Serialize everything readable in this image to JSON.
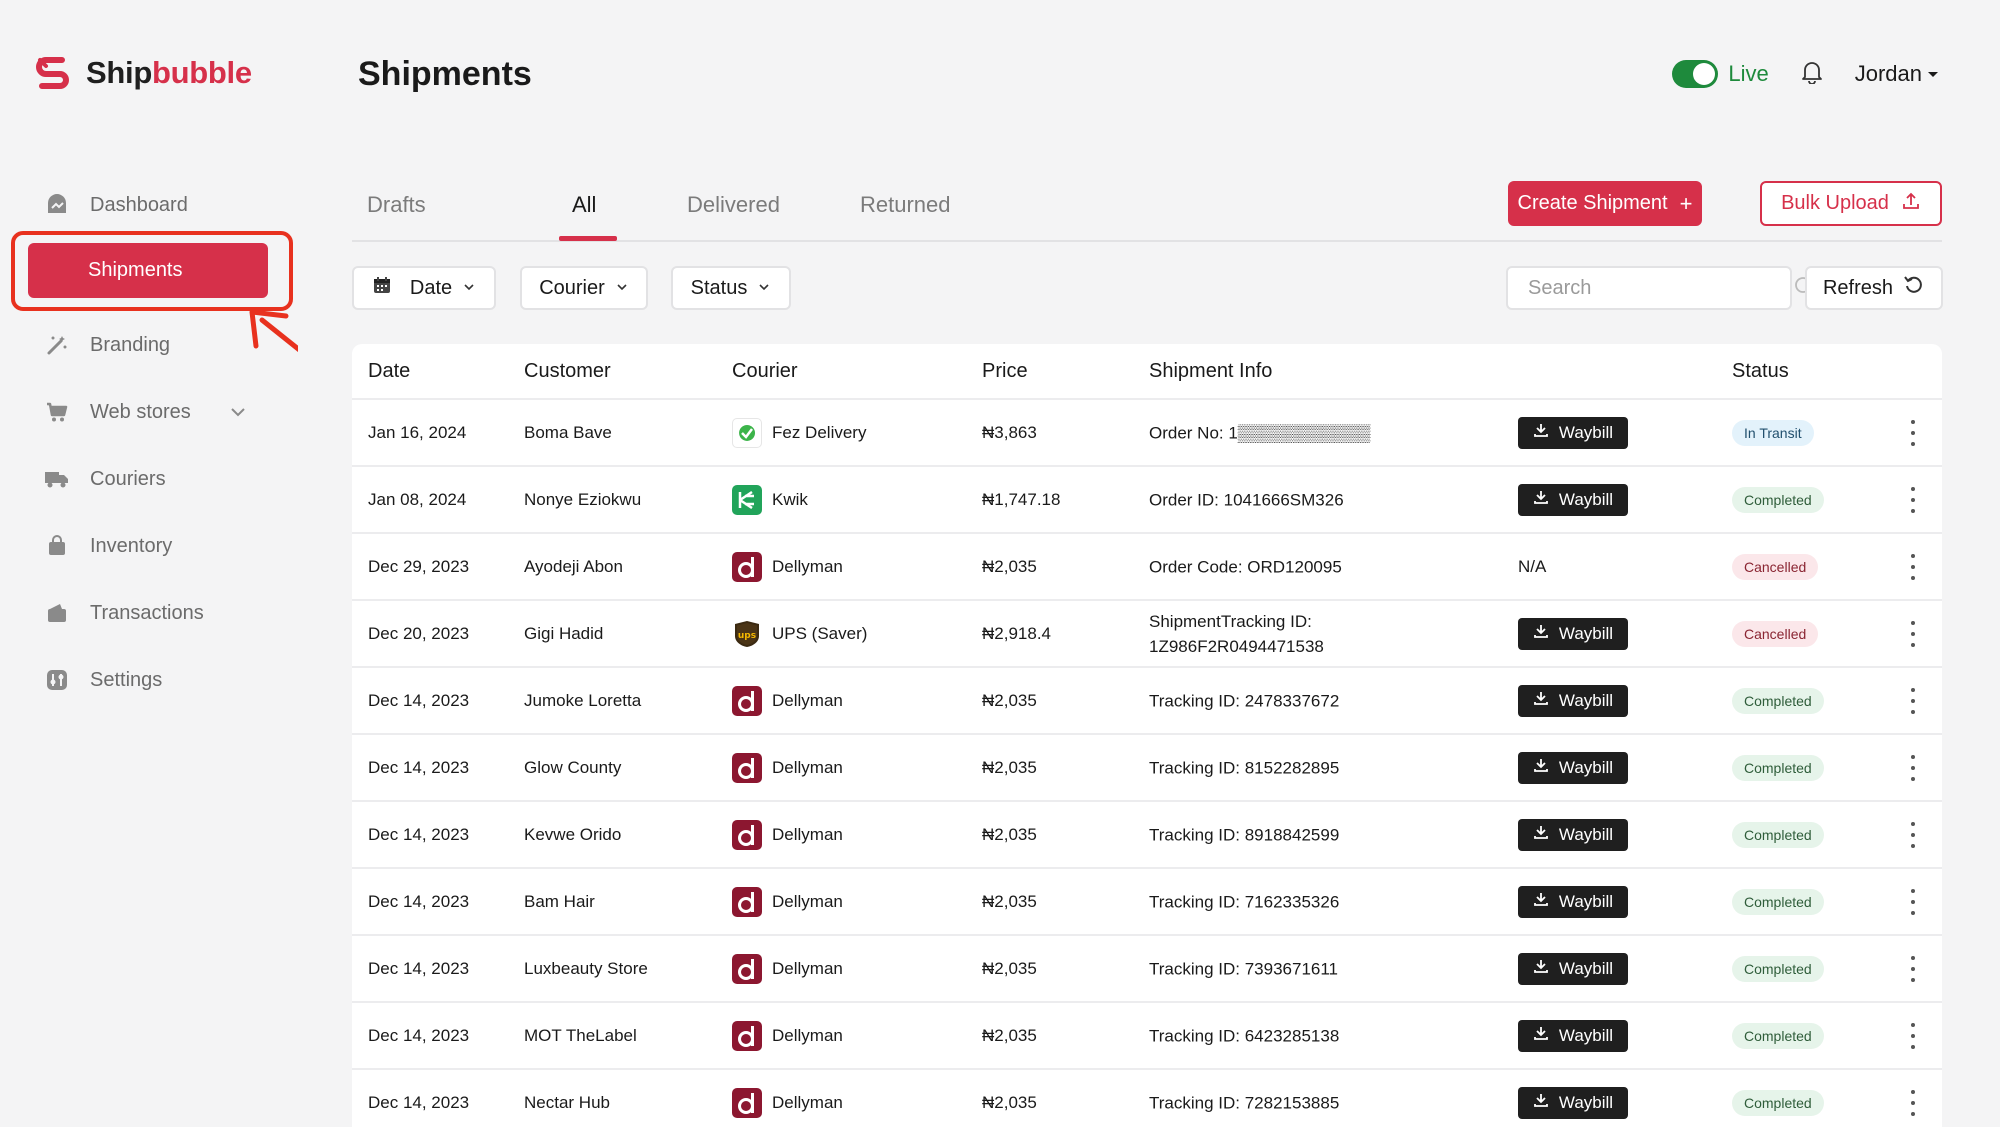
{
  "app": {
    "brand_ship": "Ship",
    "brand_bubble": "bubble",
    "accent_color": "#d6304a"
  },
  "sidebar": {
    "items": [
      {
        "label": "Dashboard",
        "icon": "chart-icon",
        "active": false
      },
      {
        "label": "Shipments",
        "icon": "box-icon",
        "active": true
      },
      {
        "label": "Branding",
        "icon": "magic-wand-icon",
        "active": false
      },
      {
        "label": "Web stores",
        "icon": "cart-icon",
        "active": false,
        "expandable": true
      },
      {
        "label": "Couriers",
        "icon": "truck-icon",
        "active": false
      },
      {
        "label": "Inventory",
        "icon": "bag-icon",
        "active": false
      },
      {
        "label": "Transactions",
        "icon": "wallet-icon",
        "active": false
      },
      {
        "label": "Settings",
        "icon": "settings-icon",
        "active": false
      }
    ]
  },
  "header": {
    "title": "Shipments",
    "live_label": "Live",
    "user_name": "Jordan"
  },
  "tabs": [
    {
      "label": "Drafts",
      "active": false
    },
    {
      "label": "All",
      "active": true
    },
    {
      "label": "Delivered",
      "active": false
    },
    {
      "label": "Returned",
      "active": false
    }
  ],
  "actions": {
    "create_label": "Create Shipment",
    "create_suffix": "+",
    "bulk_label": "Bulk Upload"
  },
  "filters": {
    "date_label": "Date",
    "courier_label": "Courier",
    "status_label": "Status",
    "search_placeholder": "Search",
    "refresh_label": "Refresh"
  },
  "table": {
    "columns": [
      "Date",
      "Customer",
      "Courier",
      "Price",
      "Shipment Info",
      "Status"
    ],
    "waybill_label": "Waybill",
    "rows": [
      {
        "date": "Jan 16, 2024",
        "customer": "Boma Bave",
        "courier": "Fez Delivery",
        "courier_logo": "fez",
        "price": "₦3,863",
        "info": "Order No: 1▒▒▒▒▒▒▒▒▒▒▒",
        "info2": "",
        "waybill": true,
        "na": "",
        "status": "In Transit",
        "status_type": "transit"
      },
      {
        "date": "Jan 08, 2024",
        "customer": "Nonye Eziokwu",
        "courier": "Kwik",
        "courier_logo": "kwik",
        "price": "₦1,747.18",
        "info": "Order ID: 1041666SM326",
        "info2": "",
        "waybill": true,
        "na": "",
        "status": "Completed",
        "status_type": "completed"
      },
      {
        "date": "Dec 29, 2023",
        "customer": "Ayodeji Abon",
        "courier": "Dellyman",
        "courier_logo": "dellyman",
        "price": "₦2,035",
        "info": "Order Code: ORD120095",
        "info2": "",
        "waybill": false,
        "na": "N/A",
        "status": "Cancelled",
        "status_type": "cancelled"
      },
      {
        "date": "Dec 20, 2023",
        "customer": "Gigi Hadid",
        "courier": "UPS (Saver)",
        "courier_logo": "ups",
        "price": "₦2,918.4",
        "info": "ShipmentTracking ID:",
        "info2": "1Z986F2R0494471538",
        "waybill": true,
        "na": "",
        "status": "Cancelled",
        "status_type": "cancelled"
      },
      {
        "date": "Dec 14, 2023",
        "customer": "Jumoke Loretta",
        "courier": "Dellyman",
        "courier_logo": "dellyman",
        "price": "₦2,035",
        "info": "Tracking ID: 2478337672",
        "info2": "",
        "waybill": true,
        "na": "",
        "status": "Completed",
        "status_type": "completed"
      },
      {
        "date": "Dec 14, 2023",
        "customer": "Glow County",
        "courier": "Dellyman",
        "courier_logo": "dellyman",
        "price": "₦2,035",
        "info": "Tracking ID: 8152282895",
        "info2": "",
        "waybill": true,
        "na": "",
        "status": "Completed",
        "status_type": "completed"
      },
      {
        "date": "Dec 14, 2023",
        "customer": "Kevwe Orido",
        "courier": "Dellyman",
        "courier_logo": "dellyman",
        "price": "₦2,035",
        "info": "Tracking ID: 8918842599",
        "info2": "",
        "waybill": true,
        "na": "",
        "status": "Completed",
        "status_type": "completed"
      },
      {
        "date": "Dec 14, 2023",
        "customer": "Bam Hair",
        "courier": "Dellyman",
        "courier_logo": "dellyman",
        "price": "₦2,035",
        "info": "Tracking ID: 7162335326",
        "info2": "",
        "waybill": true,
        "na": "",
        "status": "Completed",
        "status_type": "completed"
      },
      {
        "date": "Dec 14, 2023",
        "customer": "Luxbeauty Store",
        "courier": "Dellyman",
        "courier_logo": "dellyman",
        "price": "₦2,035",
        "info": "Tracking ID: 7393671611",
        "info2": "",
        "waybill": true,
        "na": "",
        "status": "Completed",
        "status_type": "completed"
      },
      {
        "date": "Dec 14, 2023",
        "customer": "MOT TheLabel",
        "courier": "Dellyman",
        "courier_logo": "dellyman",
        "price": "₦2,035",
        "info": "Tracking ID: 6423285138",
        "info2": "",
        "waybill": true,
        "na": "",
        "status": "Completed",
        "status_type": "completed"
      },
      {
        "date": "Dec 14, 2023",
        "customer": "Nectar Hub",
        "courier": "Dellyman",
        "courier_logo": "dellyman",
        "price": "₦2,035",
        "info": "Tracking ID: 7282153885",
        "info2": "",
        "waybill": true,
        "na": "",
        "status": "Completed",
        "status_type": "completed"
      }
    ]
  }
}
